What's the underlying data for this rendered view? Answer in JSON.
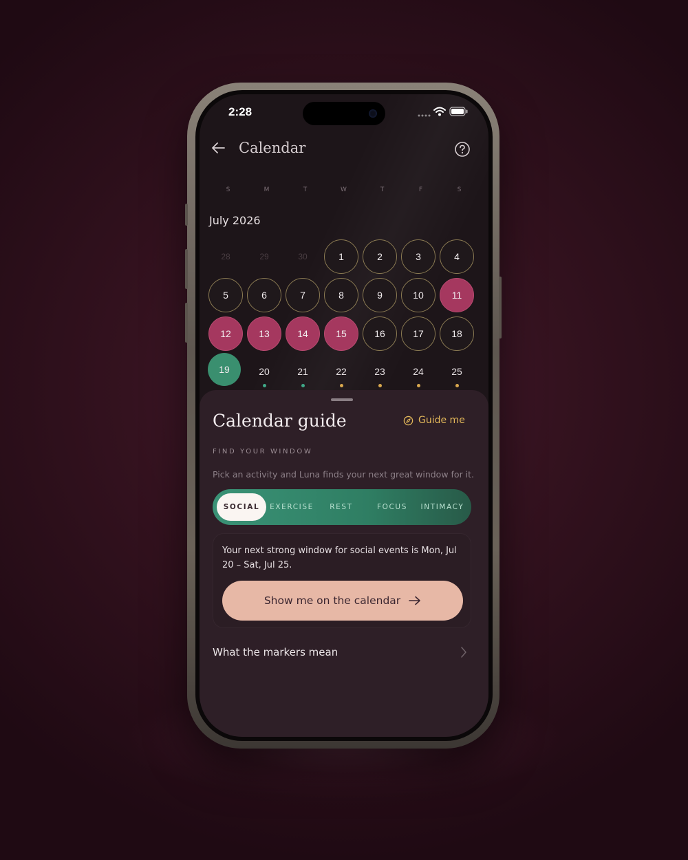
{
  "status": {
    "time": "2:28"
  },
  "nav": {
    "title": "Calendar"
  },
  "weekdays": [
    "S",
    "M",
    "T",
    "W",
    "T",
    "F",
    "S"
  ],
  "month": {
    "title": "July 2026"
  },
  "calendar": {
    "rows": [
      [
        {
          "day": "28",
          "type": "prev"
        },
        {
          "day": "29",
          "type": "prev"
        },
        {
          "day": "30",
          "type": "prev"
        },
        {
          "day": "1",
          "type": "outline"
        },
        {
          "day": "2",
          "type": "outline"
        },
        {
          "day": "3",
          "type": "outline"
        },
        {
          "day": "4",
          "type": "outline"
        }
      ],
      [
        {
          "day": "5",
          "type": "outline"
        },
        {
          "day": "6",
          "type": "outline"
        },
        {
          "day": "7",
          "type": "outline"
        },
        {
          "day": "8",
          "type": "outline"
        },
        {
          "day": "9",
          "type": "outline"
        },
        {
          "day": "10",
          "type": "outline"
        },
        {
          "day": "11",
          "type": "period"
        }
      ],
      [
        {
          "day": "12",
          "type": "period"
        },
        {
          "day": "13",
          "type": "period"
        },
        {
          "day": "14",
          "type": "period"
        },
        {
          "day": "15",
          "type": "period"
        },
        {
          "day": "16",
          "type": "outline"
        },
        {
          "day": "17",
          "type": "outline"
        },
        {
          "day": "18",
          "type": "outline"
        }
      ],
      [
        {
          "day": "19",
          "type": "fertile"
        },
        {
          "day": "20",
          "type": "plain",
          "dot": "green"
        },
        {
          "day": "21",
          "type": "plain",
          "dot": "green"
        },
        {
          "day": "22",
          "type": "plain",
          "dot": "gold"
        },
        {
          "day": "23",
          "type": "plain",
          "dot": "gold"
        },
        {
          "day": "24",
          "type": "plain",
          "dot": "gold"
        },
        {
          "day": "25",
          "type": "plain",
          "dot": "gold"
        }
      ]
    ]
  },
  "colors": {
    "period": "#a5385f",
    "fertile": "#3a8f6f",
    "outline": "#8a7a52",
    "dot_green": "#3fa888",
    "dot_gold": "#d9a84e",
    "accent_gold": "#e3b85a",
    "cta": "#e7b8a6"
  },
  "sheet": {
    "title": "Calendar guide",
    "guide_me": "Guide me",
    "overline": "FIND YOUR WINDOW",
    "description": "Pick an activity and Luna finds your next great window for it.",
    "tabs": [
      {
        "label": "SOCIAL",
        "active": true
      },
      {
        "label": "EXERCISE",
        "active": false
      },
      {
        "label": "REST",
        "active": false
      },
      {
        "label": "FOCUS",
        "active": false
      },
      {
        "label": "INTIMACY",
        "active": false
      }
    ],
    "card_text": "Your next strong window for social events is Mon, Jul 20 – Sat, Jul 25.",
    "cta_label": "Show me on the calendar",
    "markers_label": "What the markers mean"
  },
  "icons": {
    "back": "arrow-left-icon",
    "help": "help-circle-icon",
    "compass": "compass-icon",
    "cta_arrow": "arrow-right-icon",
    "chevron": "chevron-right-icon",
    "signal": "cell-signal-icon",
    "wifi": "wifi-icon",
    "battery": "battery-icon"
  }
}
